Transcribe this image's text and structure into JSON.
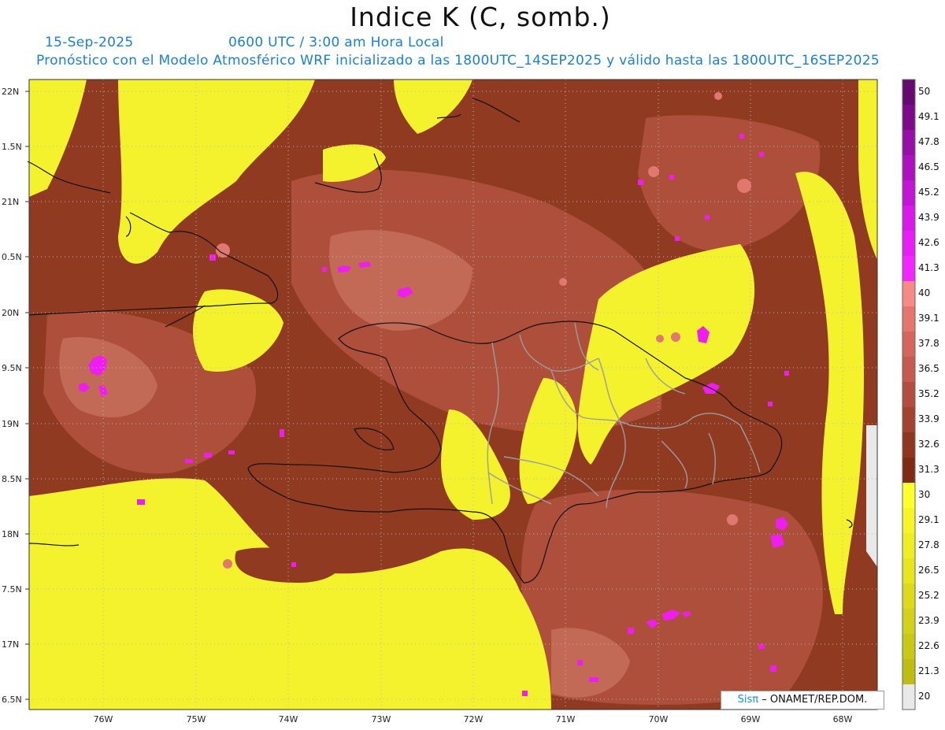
{
  "title": "Indice K (C, somb.)",
  "date": "15-Sep-2025",
  "time": "0600 UTC / 3:00 am Hora Local",
  "model_line": "Pronóstico con el Modelo Atmosférico WRF inicializado a las 1800UTC_14SEP2025 y válido hasta las  1800UTC_16SEP2025",
  "lat_labels": [
    "22N",
    "1.5N",
    "21N",
    "0.5N",
    "20N",
    "9.5N",
    "19N",
    "8.5N",
    "18N",
    "7.5N",
    "17N",
    "6.5N"
  ],
  "lon_labels": [
    "76W",
    "75W",
    "74W",
    "73W",
    "72W",
    "71W",
    "70W",
    "69W",
    "68W"
  ],
  "colorbar": {
    "labels": [
      "50",
      "49.1",
      "47.8",
      "46.5",
      "45.2",
      "43.9",
      "42.6",
      "41.3",
      "40",
      "39.1",
      "37.8",
      "36.5",
      "35.2",
      "33.9",
      "32.6",
      "31.3",
      "30",
      "29.1",
      "27.8",
      "26.5",
      "25.2",
      "23.9",
      "22.6",
      "21.3",
      "20"
    ],
    "colors": [
      "#650a6e",
      "#7c0a8a",
      "#9510a6",
      "#ab12bd",
      "#c116d3",
      "#d61ae8",
      "#e61ff4",
      "#f028ff",
      "#f68a86",
      "#e4766f",
      "#d4665e",
      "#c55a50",
      "#b34d42",
      "#a2432f",
      "#8f361e",
      "#7d2c13",
      "#ffff2e",
      "#f7f428",
      "#eeee24",
      "#e6e61f",
      "#dbdb1c",
      "#d2d21a",
      "#c8c817",
      "#bdbd14",
      "#e9e9e9"
    ]
  },
  "logo": {
    "brand": "Sisπ",
    "text": "– ONAMET/REP.DOM."
  },
  "colors": {
    "yellow": "#f7f52e",
    "dark_brown": "#8f3a21",
    "light_brown": "#c86a58",
    "magenta": "#ee1ef0"
  }
}
